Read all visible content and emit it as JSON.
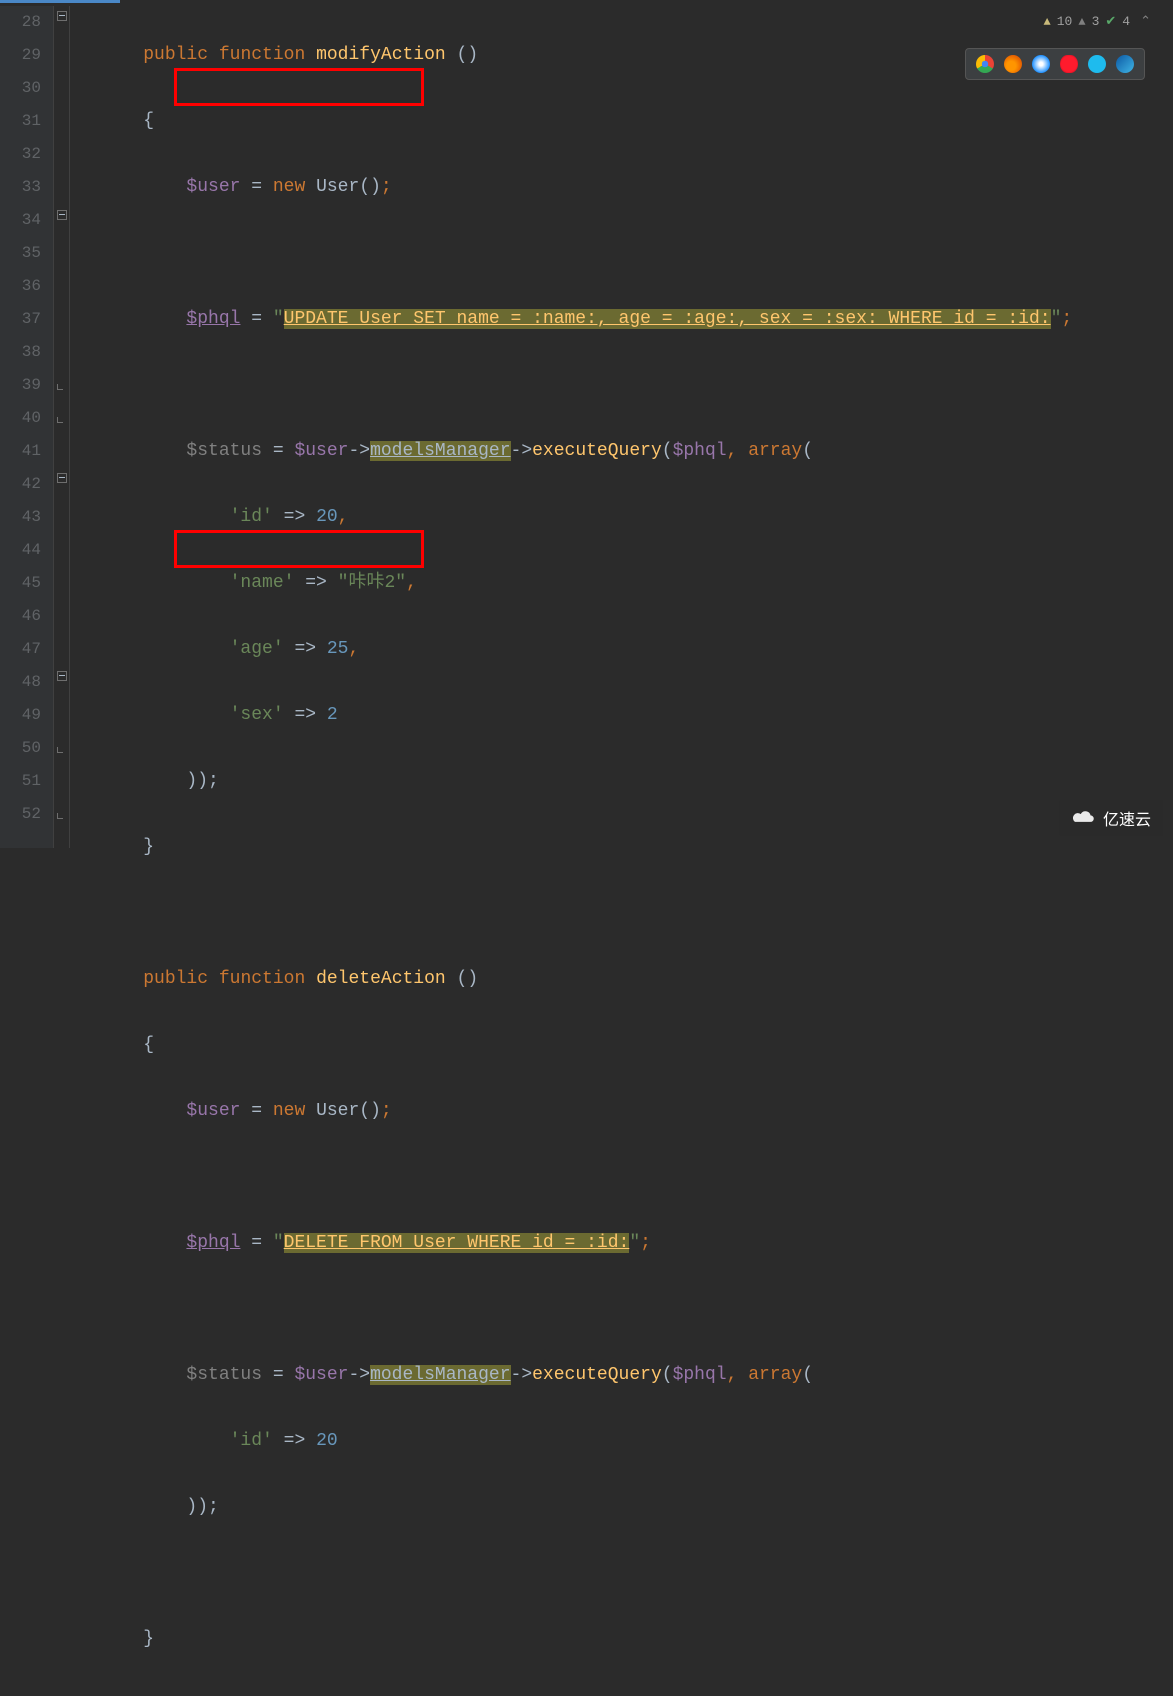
{
  "status": {
    "warn1_count": "10",
    "warn2_count": "3",
    "check_count": "4"
  },
  "gutter": {
    "start": 28,
    "end": 52
  },
  "code": {
    "l28": {
      "public": "public",
      "function": "function",
      "fn": "modifyAction",
      "paren": "()"
    },
    "l29": {
      "brace": "{"
    },
    "l30": {
      "var": "$user",
      "eq": " = ",
      "new": "new",
      "cls": "User",
      "paren": "()",
      "semi": ";"
    },
    "l32": {
      "var": "$phql",
      "eq": " = ",
      "q1": "\"",
      "sql": "UPDATE User SET name = :name:, age = :age:, sex = :sex: WHERE id = :id:",
      "q2": "\"",
      "semi": ";"
    },
    "l34": {
      "var": "$status",
      "eq": " = ",
      "v2": "$user",
      "a1": "->",
      "mm": "modelsManager",
      "a2": "->",
      "fn": "executeQuery",
      "op": "(",
      "v3": "$phql",
      "c1": ",",
      "sp": " ",
      "arr": "array",
      "op2": "("
    },
    "l35": {
      "k": "'id'",
      "ar": " => ",
      "v": "20",
      "c": ","
    },
    "l36": {
      "k": "'name'",
      "ar": " => ",
      "v": "\"咔咔2\"",
      "c": ","
    },
    "l37": {
      "k": "'age'",
      "ar": " => ",
      "v": "25",
      "c": ","
    },
    "l38": {
      "k": "'sex'",
      "ar": " => ",
      "v": "2"
    },
    "l39": {
      "cl": "));"
    },
    "l40": {
      "brace": "}"
    },
    "l42": {
      "public": "public",
      "function": "function",
      "fn": "deleteAction",
      "paren": "()"
    },
    "l43": {
      "brace": "{"
    },
    "l44": {
      "var": "$user",
      "eq": " = ",
      "new": "new",
      "cls": "User",
      "paren": "()",
      "semi": ";"
    },
    "l46": {
      "var": "$phql",
      "eq": " = ",
      "q1": "\"",
      "sql": "DELETE FROM User WHERE id = :id:",
      "q2": "\"",
      "semi": ";"
    },
    "l48": {
      "var": "$status",
      "eq": " = ",
      "v2": "$user",
      "a1": "->",
      "mm": "modelsManager",
      "a2": "->",
      "fn": "executeQuery",
      "op": "(",
      "v3": "$phql",
      "c1": ",",
      "sp": " ",
      "arr": "array",
      "op2": "("
    },
    "l49": {
      "k": "'id'",
      "ar": " => ",
      "v": "20"
    },
    "l50": {
      "cl": "));"
    },
    "l52": {
      "brace": "}"
    }
  },
  "watermark": {
    "text": "亿速云"
  }
}
